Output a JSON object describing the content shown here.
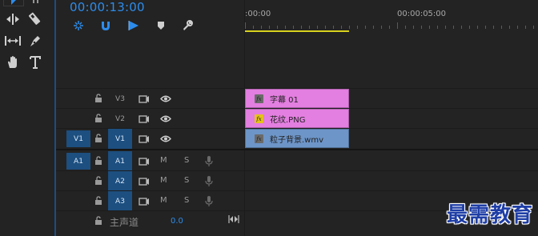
{
  "timecode": "00:00:13:00",
  "ruler": {
    "labels": [
      ":00:00",
      "00:00:05:00"
    ]
  },
  "video_tracks": [
    {
      "target": "V3",
      "source": "",
      "target_on": false,
      "clip": {
        "name": "字幕 01",
        "color": "#e37fe0",
        "fx_active": false
      }
    },
    {
      "target": "V2",
      "source": "",
      "target_on": false,
      "clip": {
        "name": "花纹.PNG",
        "color": "#e37fe0",
        "fx_active": true
      }
    },
    {
      "target": "V1",
      "source": "V1",
      "target_on": true,
      "clip": {
        "name": "粒子背景.wmv",
        "color": "#6d95c8",
        "fx_active": false
      }
    }
  ],
  "audio_tracks": [
    {
      "target": "A1",
      "source": "A1",
      "target_on": true,
      "mute": "M",
      "solo": "S"
    },
    {
      "target": "A2",
      "source": "",
      "target_on": true,
      "mute": "M",
      "solo": "S"
    },
    {
      "target": "A3",
      "source": "",
      "target_on": true,
      "mute": "M",
      "solo": "S"
    }
  ],
  "master": {
    "label": "主声道",
    "value": "0.0"
  },
  "watermark": "最需教育",
  "colors": {
    "accent_blue": "#2d8ceb",
    "track_target": "#1d4f80",
    "clip_pink": "#e37fe0",
    "clip_blue": "#6d95c8",
    "work_area": "#d8d21e"
  },
  "icons": {
    "tools": [
      "selection-tool-icon",
      "track-select-icon",
      "ripple-edit-icon",
      "razor-icon",
      "slip-icon",
      "pen-icon",
      "hand-icon",
      "type-icon"
    ],
    "header": [
      "snap-icon",
      "magnet-link-icon",
      "add-marker-icon",
      "marker-icon",
      "wrench-icon"
    ]
  }
}
